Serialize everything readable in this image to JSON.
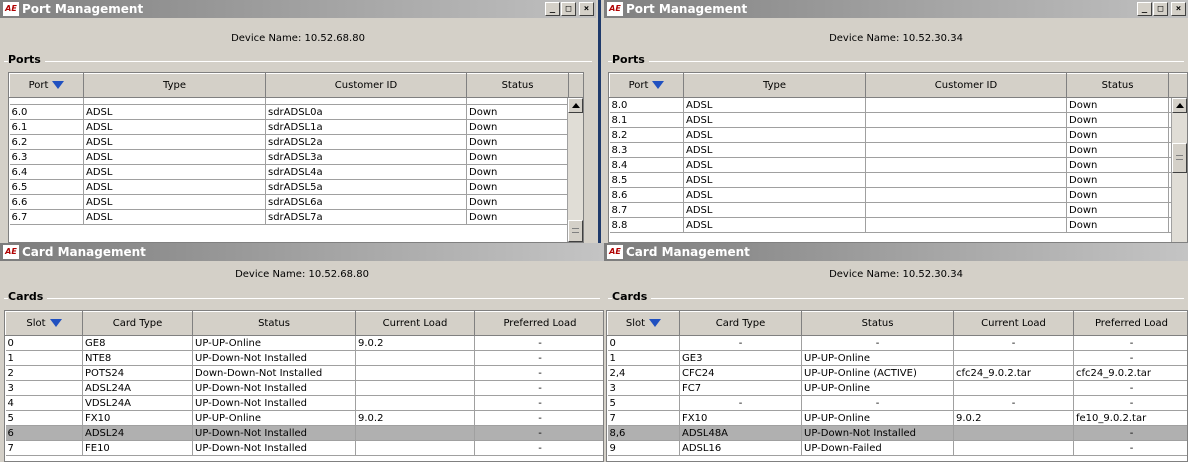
{
  "port_left": {
    "title": "Port Management",
    "device_name": "Device Name:  10.52.68.80",
    "section": "Ports",
    "columns": [
      "Port",
      "Type",
      "Customer ID",
      "Status"
    ],
    "rows": [
      [
        "6.0",
        "ADSL",
        "sdrADSL0a",
        "Down"
      ],
      [
        "6.1",
        "ADSL",
        "sdrADSL1a",
        "Down"
      ],
      [
        "6.2",
        "ADSL",
        "sdrADSL2a",
        "Down"
      ],
      [
        "6.3",
        "ADSL",
        "sdrADSL3a",
        "Down"
      ],
      [
        "6.4",
        "ADSL",
        "sdrADSL4a",
        "Down"
      ],
      [
        "6.5",
        "ADSL",
        "sdrADSL5a",
        "Down"
      ],
      [
        "6.6",
        "ADSL",
        "sdrADSL6a",
        "Down"
      ],
      [
        "6.7",
        "ADSL",
        "sdrADSL7a",
        "Down"
      ]
    ]
  },
  "port_right": {
    "title": "Port Management",
    "device_name": "Device Name:  10.52.30.34",
    "section": "Ports",
    "columns": [
      "Port",
      "Type",
      "Customer ID",
      "Status"
    ],
    "rows": [
      [
        "8.0",
        "ADSL",
        "",
        "Down"
      ],
      [
        "8.1",
        "ADSL",
        "",
        "Down"
      ],
      [
        "8.2",
        "ADSL",
        "",
        "Down"
      ],
      [
        "8.3",
        "ADSL",
        "",
        "Down"
      ],
      [
        "8.4",
        "ADSL",
        "",
        "Down"
      ],
      [
        "8.5",
        "ADSL",
        "",
        "Down"
      ],
      [
        "8.6",
        "ADSL",
        "",
        "Down"
      ],
      [
        "8.7",
        "ADSL",
        "",
        "Down"
      ],
      [
        "8.8",
        "ADSL",
        "",
        "Down"
      ]
    ]
  },
  "card_left": {
    "title": "Card Management",
    "device_name": "Device Name:  10.52.68.80",
    "section": "Cards",
    "columns": [
      "Slot",
      "Card Type",
      "Status",
      "Current Load",
      "Preferred Load"
    ],
    "rows": [
      [
        "0",
        "GE8",
        "UP-UP-Online",
        "9.0.2",
        "-"
      ],
      [
        "1",
        "NTE8",
        "UP-Down-Not Installed",
        "",
        "-"
      ],
      [
        "2",
        "POTS24",
        "Down-Down-Not Installed",
        "",
        "-"
      ],
      [
        "3",
        "ADSL24A",
        "UP-Down-Not Installed",
        "",
        "-"
      ],
      [
        "4",
        "VDSL24A",
        "UP-Down-Not Installed",
        "",
        "-"
      ],
      [
        "5",
        "FX10",
        "UP-UP-Online",
        "9.0.2",
        "-"
      ],
      [
        "6",
        "ADSL24",
        "UP-Down-Not Installed",
        "",
        "-"
      ],
      [
        "7",
        "FE10",
        "UP-Down-Not Installed",
        "",
        "-"
      ]
    ],
    "selected_row": 6
  },
  "card_right": {
    "title": "Card Management",
    "device_name": "Device Name:  10.52.30.34",
    "section": "Cards",
    "columns": [
      "Slot",
      "Card Type",
      "Status",
      "Current Load",
      "Preferred Load"
    ],
    "rows": [
      [
        "0",
        "-",
        "-",
        "-",
        "-"
      ],
      [
        "1",
        "GE3",
        "UP-UP-Online",
        "",
        "-"
      ],
      [
        "2,4",
        "CFC24",
        "UP-UP-Online (ACTIVE)",
        "cfc24_9.0.2.tar",
        "cfc24_9.0.2.tar"
      ],
      [
        "3",
        "FC7",
        "UP-UP-Online",
        "",
        "-"
      ],
      [
        "5",
        "-",
        "-",
        "-",
        "-"
      ],
      [
        "7",
        "FX10",
        "UP-UP-Online",
        "9.0.2",
        "fe10_9.0.2.tar"
      ],
      [
        "8,6",
        "ADSL48A",
        "UP-Down-Not Installed",
        "",
        "-"
      ],
      [
        "9",
        "ADSL16",
        "UP-Down-Failed",
        "",
        "-"
      ]
    ],
    "selected_row": 6
  },
  "icons": {
    "app_logo": "app-logo-icon",
    "sort": "sort-descending-icon",
    "minimize": "minimize-icon",
    "maximize": "maximize-icon",
    "close": "close-icon"
  },
  "colors": {
    "titlebar": "#9a9a9a",
    "selection": "#b0b0b0",
    "sort_arrow": "#2050c0"
  }
}
